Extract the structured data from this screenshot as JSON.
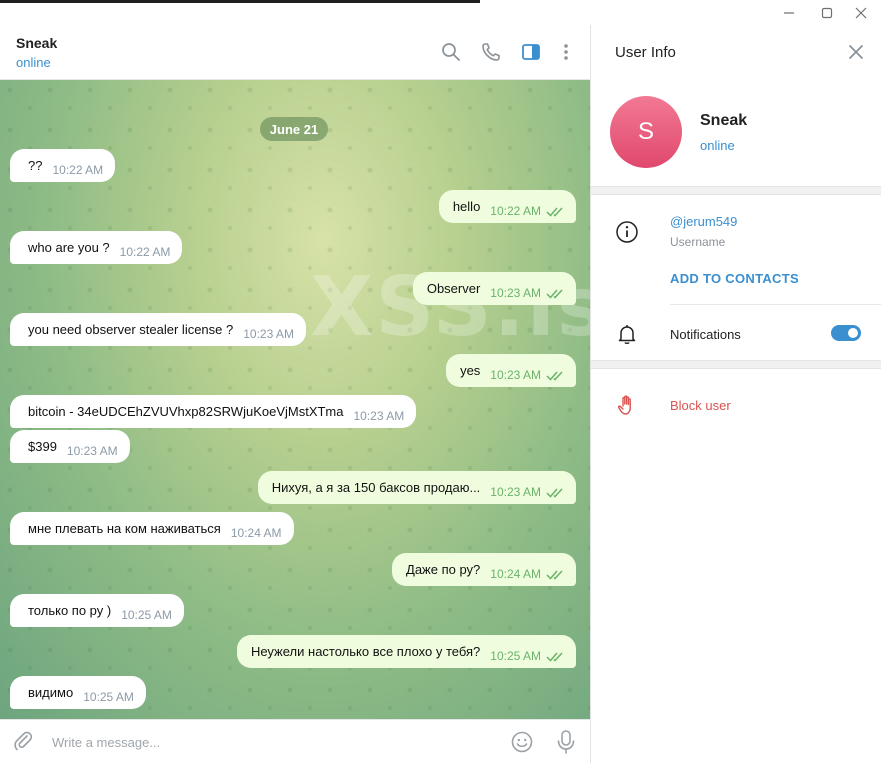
{
  "window": {
    "controls": [
      "minimize",
      "maximize",
      "close"
    ]
  },
  "chat": {
    "title": "Sneak",
    "status": "online",
    "date": "June 21",
    "watermark": "XSS.is",
    "messages": [
      {
        "dir": "in",
        "text": "??",
        "time": "10:22 AM"
      },
      {
        "dir": "out",
        "text": "hello",
        "time": "10:22 AM"
      },
      {
        "dir": "in",
        "text": "who are you ?",
        "time": "10:22 AM"
      },
      {
        "dir": "out",
        "text": "Observer",
        "time": "10:23 AM"
      },
      {
        "dir": "in",
        "text": "you need observer stealer license ?",
        "time": "10:23 AM"
      },
      {
        "dir": "out",
        "text": "yes",
        "time": "10:23 AM"
      },
      {
        "dir": "in",
        "text": "bitcoin - 34eUDCEhZVUVhxp82SRWjuKoeVjMstXTma",
        "time": "10:23 AM"
      },
      {
        "dir": "in",
        "text": "$399",
        "time": "10:23 AM"
      },
      {
        "dir": "out",
        "text": "Нихуя, а я за 150 баксов продаю...",
        "time": "10:23 AM"
      },
      {
        "dir": "in",
        "text": "мне плевать на ком наживаться",
        "time": "10:24 AM"
      },
      {
        "dir": "out",
        "text": "Даже по ру?",
        "time": "10:24 AM"
      },
      {
        "dir": "in",
        "text": "только по ру )",
        "time": "10:25 AM"
      },
      {
        "dir": "out",
        "text": "Неужели настолько все плохо у тебя?",
        "time": "10:25 AM"
      },
      {
        "dir": "in",
        "text": "видимо",
        "time": "10:25 AM"
      }
    ],
    "compose_placeholder": "Write a message..."
  },
  "info": {
    "title": "User Info",
    "avatar_letter": "S",
    "name": "Sneak",
    "status": "online",
    "username": "@jerum549",
    "username_label": "Username",
    "add_contacts": "ADD TO CONTACTS",
    "notifications_label": "Notifications",
    "notifications_on": true,
    "block_label": "Block user"
  },
  "colors": {
    "accent": "#3a8fd0",
    "outgoing_bubble": "#effdde",
    "block_red": "#d9534f",
    "avatar": "#e8567a"
  }
}
